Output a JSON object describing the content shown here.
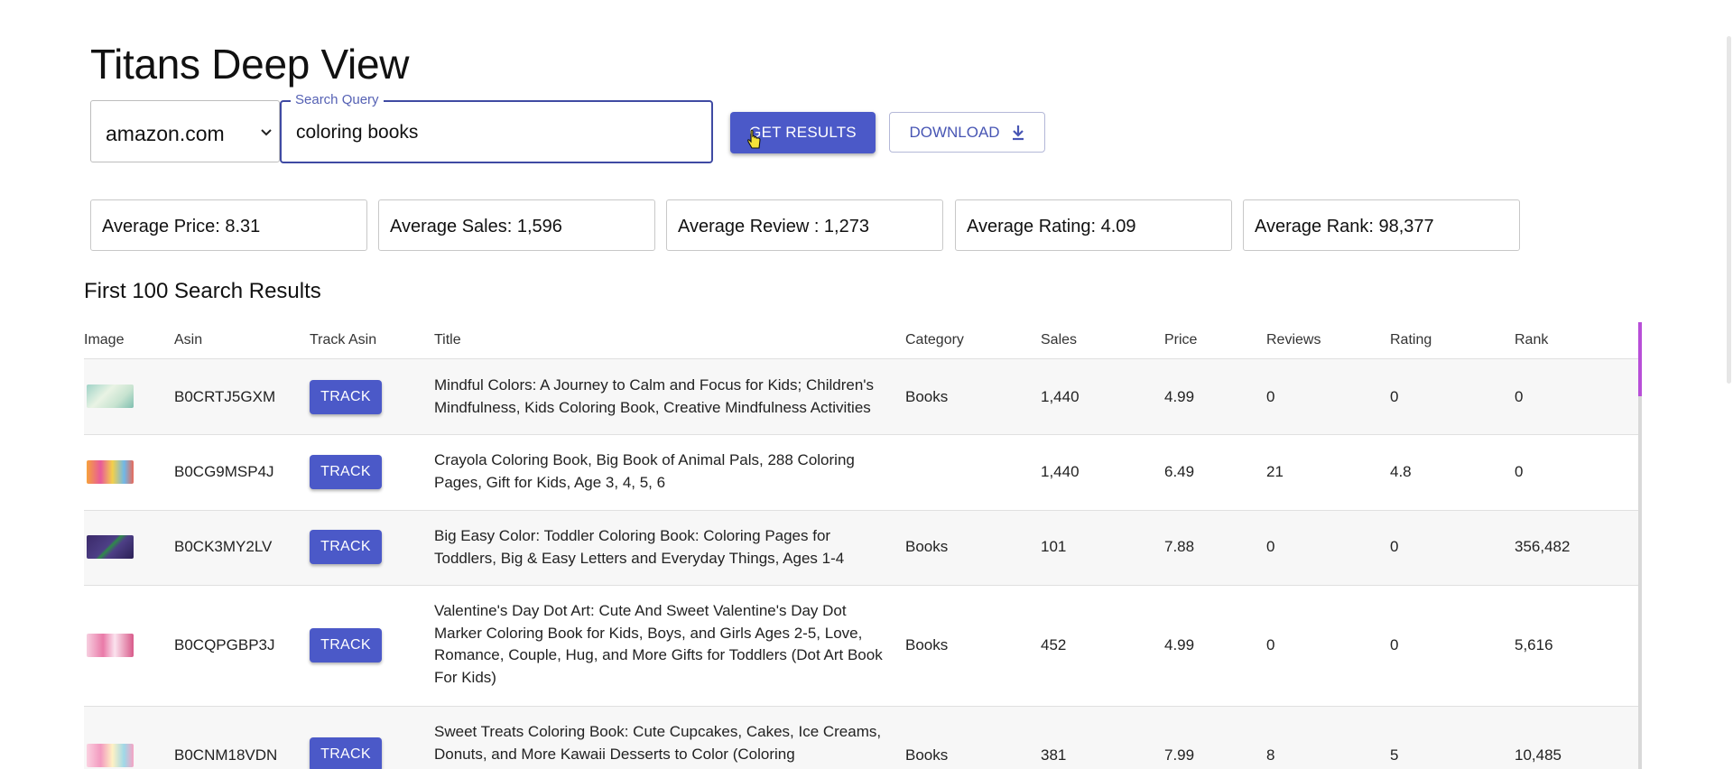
{
  "app": {
    "title": "Titans Deep View"
  },
  "search": {
    "site_value": "amazon.com",
    "query_label": "Search Query",
    "query_value": "coloring books",
    "get_results_label": "GET RESULTS",
    "download_label": "DOWNLOAD"
  },
  "stats": {
    "avg_price": "Average Price: 8.31",
    "avg_sales": "Average Sales: 1,596",
    "avg_review": "Average Review : 1,273",
    "avg_rating": "Average Rating: 4.09",
    "avg_rank": "Average Rank: 98,377"
  },
  "results": {
    "heading": "First 100 Search Results",
    "columns": {
      "image": "Image",
      "asin": "Asin",
      "track": "Track Asin",
      "title": "Title",
      "category": "Category",
      "sales": "Sales",
      "price": "Price",
      "reviews": "Reviews",
      "rating": "Rating",
      "rank": "Rank"
    },
    "rows": [
      {
        "asin": "B0CRTJ5GXM",
        "track": "TRACK",
        "title": "Mindful Colors: A Journey to Calm and Focus for Kids; Children's Mindfulness, Kids Coloring Book, Creative Mindfulness Activities",
        "category": "Books",
        "sales": "1,440",
        "price": "4.99",
        "reviews": "0",
        "rating": "0",
        "rank": "0"
      },
      {
        "asin": "B0CG9MSP4J",
        "track": "TRACK",
        "title": "Crayola Coloring Book, Big Book of Animal Pals, 288 Coloring Pages, Gift for Kids, Age 3, 4, 5, 6",
        "category": "",
        "sales": "1,440",
        "price": "6.49",
        "reviews": "21",
        "rating": "4.8",
        "rank": "0"
      },
      {
        "asin": "B0CK3MY2LV",
        "track": "TRACK",
        "title": "Big Easy Color: Toddler Coloring Book: Coloring Pages for Toddlers, Big & Easy Letters and Everyday Things, Ages 1-4",
        "category": "Books",
        "sales": "101",
        "price": "7.88",
        "reviews": "0",
        "rating": "0",
        "rank": "356,482"
      },
      {
        "asin": "B0CQPGBP3J",
        "track": "TRACK",
        "title": "Valentine's Day Dot Art: Cute And Sweet Valentine's Day Dot Marker Coloring Book for Kids, Boys, and Girls Ages 2-5, Love, Romance, Couple, Hug, and More Gifts for Toddlers (Dot Art Book For Kids)",
        "category": "Books",
        "sales": "452",
        "price": "4.99",
        "reviews": "0",
        "rating": "0",
        "rank": "5,616"
      },
      {
        "asin": "B0CNM18VDN",
        "track": "TRACK",
        "title": "Sweet Treats Coloring Book: Cute Cupcakes, Cakes, Ice Creams, Donuts, and More Kawaii Desserts to Color (Coloring",
        "category": "Books",
        "sales": "381",
        "price": "7.99",
        "reviews": "8",
        "rating": "5",
        "rank": "10,485"
      }
    ]
  },
  "colors": {
    "primary": "#4b59c8",
    "focus_border": "#3f4aa3",
    "scroll_accent": "#b84fd8"
  }
}
